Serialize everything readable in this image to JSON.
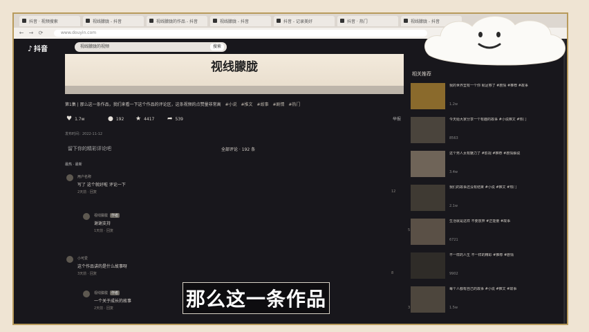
{
  "browser": {
    "tabs": [
      {
        "label": "抖音 · 视频搜索"
      },
      {
        "label": "视线朦胧 - 抖音"
      },
      {
        "label": "视线朦胧的作品 - 抖音"
      },
      {
        "label": "视线朦胧 - 抖音"
      },
      {
        "label": "抖音 - 记录美好"
      },
      {
        "label": "抖音 · 热门"
      },
      {
        "label": "视线朦胧 - 抖音"
      }
    ],
    "nav": {
      "back": "←",
      "forward": "→",
      "reload": "⟳"
    },
    "url": "www.douyin.com"
  },
  "site": {
    "logo_icon": "♪",
    "logo_text": "抖音",
    "search_value": "视线朦胧的视频",
    "search_button": "搜索"
  },
  "video": {
    "banner_title": "视线朦胧",
    "description": "第1集 | 那么这一条作品，我们来看一下这个作品的评论区，这条视频的点赞量非常高",
    "tags": [
      "#小说",
      "#推文",
      "#故事",
      "#剧情",
      "#热门"
    ],
    "actions": {
      "like": "1.7w",
      "comment": "192",
      "collect": "4417",
      "share": "539"
    },
    "more": "举报"
  },
  "meta": {
    "publish": "发布时间：2022-11-12"
  },
  "comments_section": {
    "reply_hint": "留下你的精彩评论吧",
    "summary": "全部评论 · 192 条",
    "sort": "最热 · 最新"
  },
  "comments": [
    {
      "name": "用户名称",
      "text": "写了 这个就好啦 评论一下",
      "time": "2天前 · 回复",
      "likes": "12"
    },
    {
      "name": "视线朦胧",
      "badge": "作者",
      "text": "谢谢支持",
      "time": "1天前 · 回复",
      "likes": "5"
    },
    {
      "name": "小可爱",
      "text": "这个作品讲的是什么故事呀",
      "time": "3天前 · 回复",
      "likes": "8"
    },
    {
      "name": "视线朦胧",
      "badge": "作者",
      "text": "一个关于成长的故事",
      "time": "2天前 · 回复",
      "likes": "3"
    }
  ],
  "subtitle": "那么这一条作品",
  "sidebar": {
    "title": "相关推荐",
    "items": [
      {
        "text": "我的世界里有一个你 就足够了 #剧情 #推荐 #故事",
        "meta": "1.2w"
      },
      {
        "text": "今天给大家分享一个有趣的故事 #小说推文 #热门",
        "meta": "8563"
      },
      {
        "text": "这个男人太有魅力了 #影视 #推荐 #剧情解说",
        "meta": "3.4w"
      },
      {
        "text": "我们的故事还没有结束 #小说 #推文 #热门",
        "meta": "2.1w"
      },
      {
        "text": "生活就是这样 不要放弃 #正能量 #故事",
        "meta": "6721"
      },
      {
        "text": "不一样的人生 不一样的精彩 #推荐 #剧情",
        "meta": "9902"
      },
      {
        "text": "每个人都有自己的故事 #小说 #推文 #故事",
        "meta": "1.5w"
      }
    ]
  },
  "colors": {
    "page_bg": "#18171c",
    "frame_border": "#b89a5b",
    "banner_bg": "#f3eadc",
    "subtitle_bg": "#0e0d10"
  }
}
